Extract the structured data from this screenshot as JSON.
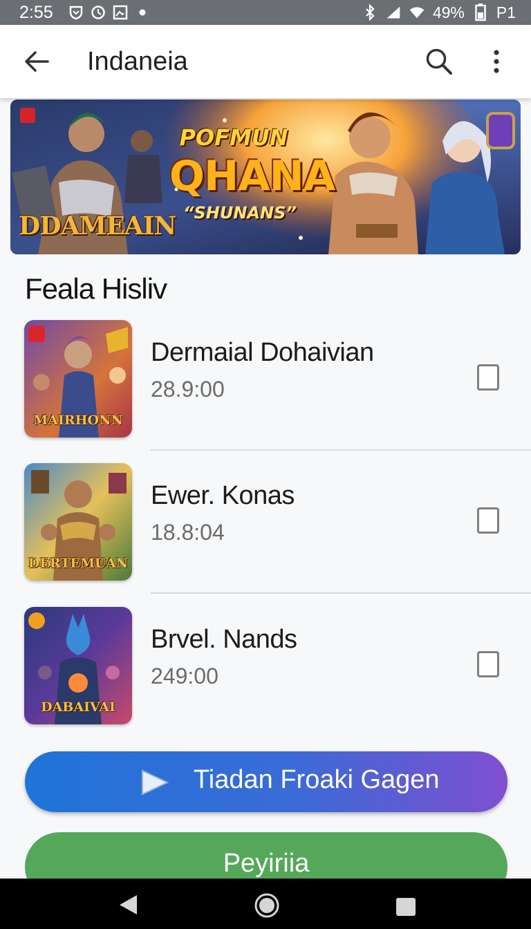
{
  "status_bar": {
    "time": "2:55",
    "battery": "49%",
    "carrier": "P1",
    "icons": [
      "shield-icon",
      "clock-icon",
      "image-icon",
      "dot-icon",
      "bluetooth-icon",
      "cell-signal-icon",
      "wifi-icon",
      "battery-icon"
    ]
  },
  "app_bar": {
    "title": "Indaneia"
  },
  "banner": {
    "title_line1": "POFMUN",
    "title_line2": "QHANA",
    "subtitle": "“SHUNANS”",
    "logo_text": "DDAMEAIN"
  },
  "section": {
    "heading": "Feala Hisliv"
  },
  "items": [
    {
      "title": "Dermaial Dohaivian",
      "time": "28.9:00",
      "thumb_text": "MAIRHONN",
      "checked": false
    },
    {
      "title": "Ewer. Konas",
      "time": "18.8:04",
      "thumb_text": "DERTEMUAN",
      "checked": false
    },
    {
      "title": "Brvel. Nands",
      "time": "249:00",
      "thumb_text": "DABAIVAI",
      "checked": false
    }
  ],
  "buttons": {
    "primary": "Tiadan Froaki Gagen",
    "secondary": "Peyiriia"
  },
  "colors": {
    "primary_gradient_start": "#1f74d8",
    "primary_gradient_end": "#7f4fd0",
    "secondary": "#55a85a",
    "status_bar": "#6b6f73"
  }
}
